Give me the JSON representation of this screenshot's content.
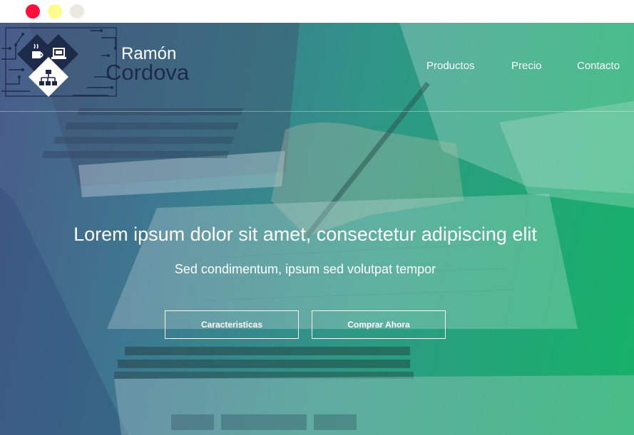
{
  "window": {
    "controls": [
      "close",
      "minimize",
      "maximize"
    ]
  },
  "brand": {
    "first_name": "Ramón",
    "last_name": "Cordova",
    "logo_icons": [
      "coffee-icon",
      "laptop-icon",
      "sitemap-icon"
    ]
  },
  "nav": {
    "items": [
      {
        "label": "Productos"
      },
      {
        "label": "Precio"
      },
      {
        "label": "Contacto"
      }
    ]
  },
  "hero": {
    "title": "Lorem ipsum dolor sit amet, consectetur adipiscing elit",
    "subtitle": "Sed condimentum, ipsum sed volutpat tempor",
    "buttons": [
      {
        "label": "Caracteristicas"
      },
      {
        "label": "Comprar Ahora"
      }
    ]
  },
  "colors": {
    "gradient_start": "#4a5c86",
    "gradient_end": "#17b06a",
    "brand_dark": "#1e2a4a",
    "close": "#ff0f3c",
    "minimize": "#fdfb8c",
    "maximize": "#ece9e1"
  }
}
